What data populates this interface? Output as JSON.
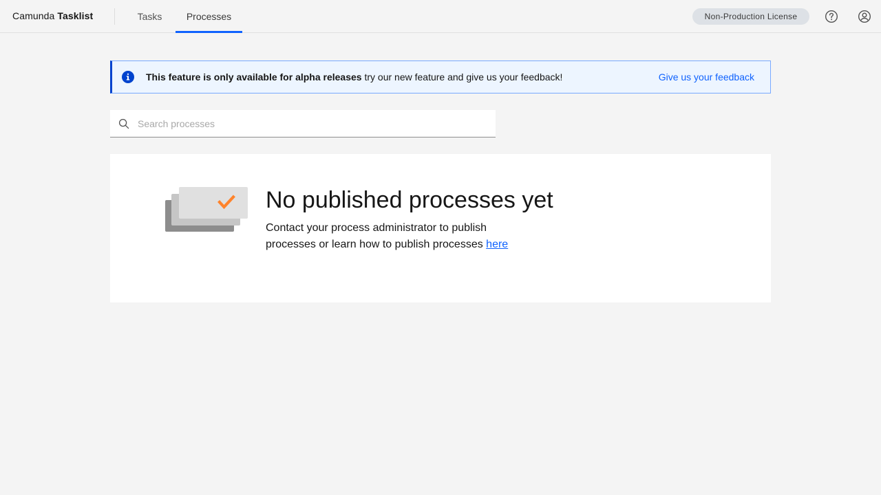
{
  "header": {
    "brand_prefix": "Camunda",
    "brand_name": "Tasklist",
    "tabs": [
      {
        "label": "Tasks"
      },
      {
        "label": "Processes"
      }
    ],
    "license_badge": "Non-Production License",
    "icons": {
      "help": "help-icon",
      "user": "user-avatar-icon"
    }
  },
  "notification": {
    "icon": "info-icon",
    "title": "This feature is only available for alpha releases",
    "message": " try our new feature and give us your feedback!",
    "action_label": "Give us your feedback"
  },
  "search": {
    "placeholder": "Search processes",
    "value": "",
    "icon": "search-icon"
  },
  "empty_state": {
    "title": "No published processes yet",
    "description": "Contact your process administrator to publish processes or learn how to publish processes ",
    "link_label": "here",
    "illustration": "empty-processes-illustration"
  },
  "colors": {
    "accent": "#0f62fe",
    "info_border": "#0043ce",
    "info_bg": "#edf5ff",
    "check": "#ff832b",
    "background": "#f4f4f4"
  }
}
